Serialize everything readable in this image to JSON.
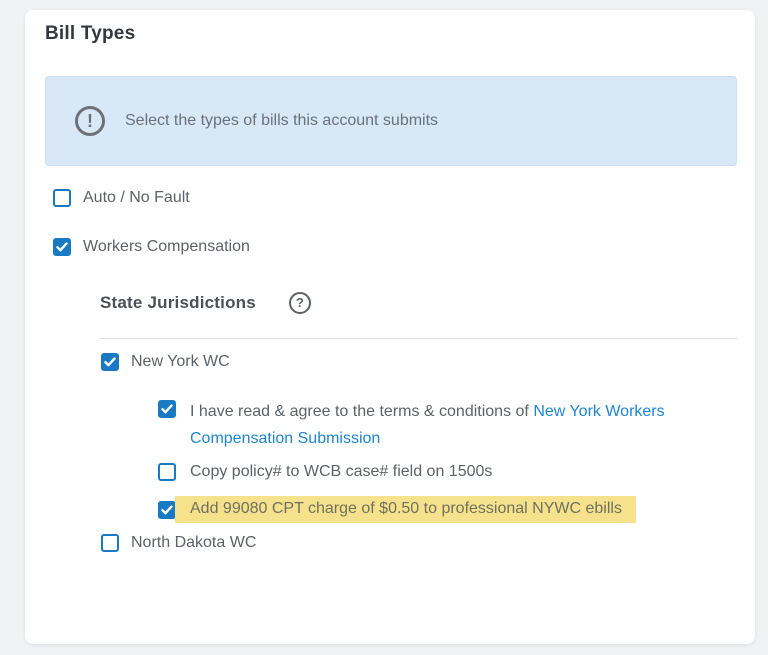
{
  "card": {
    "title": "Bill Types"
  },
  "alert": {
    "icon": "exclamation-circle-icon",
    "icon_glyph": "!",
    "text": "Select the types of bills this account submits"
  },
  "checkboxes": {
    "auto": {
      "label": "Auto / No Fault",
      "checked": false
    },
    "workers": {
      "label": "Workers Compensation",
      "checked": true
    },
    "new_york": {
      "label": "New York WC",
      "checked": true
    },
    "terms": {
      "prefix": "I have read & agree to the terms & conditions of ",
      "link": "New York Workers Compensation Submission",
      "checked": true
    },
    "copy_policy": {
      "label": "Copy policy# to WCB case# field on 1500s",
      "checked": false
    },
    "add_charge": {
      "label": "Add 99080 CPT charge of $0.50 to professional NYWC ebills",
      "checked": true,
      "highlighted": true
    },
    "north_dakota": {
      "label": "North Dakota WC",
      "checked": false
    }
  },
  "jurisdictions": {
    "heading": "State Jurisdictions",
    "help_icon": "question-circle-icon",
    "help_glyph": "?"
  },
  "colors": {
    "accent_blue": "#1979c3",
    "link_blue": "#1e86d1",
    "highlight_yellow": "#f6e28d",
    "alert_background": "#d9e8f6",
    "page_background": "#f0f2f4"
  }
}
